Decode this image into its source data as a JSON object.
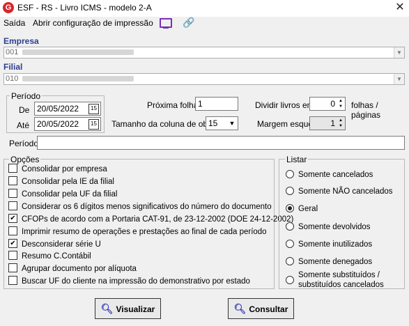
{
  "window": {
    "title": "ESF - RS - Livro ICMS - modelo 2-A",
    "app_icon_letter": "G"
  },
  "menu": {
    "items": [
      "Saída",
      "Abrir configuração de impressão"
    ],
    "icons": [
      "monitor-icon",
      "link-icon"
    ]
  },
  "empresa": {
    "label": "Empresa",
    "value": "001"
  },
  "filial": {
    "label": "Filial",
    "value": "010"
  },
  "periodo": {
    "group_label": "Período",
    "de_label": "De",
    "de_value": "20/05/2022",
    "ate_label": "Até",
    "ate_value": "20/05/2022"
  },
  "proxima_folha": {
    "label": "Próxima folha",
    "value": "1"
  },
  "dividir_livros": {
    "label": "Dividir livros em",
    "value": "0",
    "suffix": "folhas / páginas"
  },
  "tamanho_coluna": {
    "label": "Tamanho da coluna de obs.",
    "value": "15"
  },
  "margem_esquerda": {
    "label": "Margem esquerda",
    "value": "1"
  },
  "periodo_text": {
    "label": "Período",
    "value": ""
  },
  "opcoes": {
    "group_label": "Opções",
    "items": [
      {
        "label": "Consolidar por empresa",
        "checked": false
      },
      {
        "label": "Consolidar pela IE da filial",
        "checked": false
      },
      {
        "label": "Consolidar pela UF da filial",
        "checked": false
      },
      {
        "label": "Considerar os 6 dígitos menos significativos do número do documento",
        "checked": false
      },
      {
        "label": "CFOPs de acordo com a Portaria CAT-91, de 23-12-2002 (DOE 24-12-2002)",
        "checked": true
      },
      {
        "label": "Imprimir resumo de operações e prestações ao final de cada período",
        "checked": false
      },
      {
        "label": "Desconsiderar série U",
        "checked": true
      },
      {
        "label": "Resumo C.Contábil",
        "checked": false
      },
      {
        "label": "Agrupar documento por alíquota",
        "checked": false
      },
      {
        "label": "Buscar UF do cliente na impressão do demonstrativo por estado",
        "checked": false
      }
    ]
  },
  "listar": {
    "group_label": "Listar",
    "items": [
      {
        "label": "Somente cancelados",
        "selected": false
      },
      {
        "label": "Somente NÃO cancelados",
        "selected": false
      },
      {
        "label": "Geral",
        "selected": true
      },
      {
        "label": "Somente devolvidos",
        "selected": false
      },
      {
        "label": "Somente inutilizados",
        "selected": false
      },
      {
        "label": "Somente denegados",
        "selected": false
      },
      {
        "label": "Somente substituídos /",
        "label2": "substituídos cancelados",
        "selected": false
      }
    ]
  },
  "buttons": {
    "visualizar": "Visualizar",
    "consultar": "Consultar"
  }
}
